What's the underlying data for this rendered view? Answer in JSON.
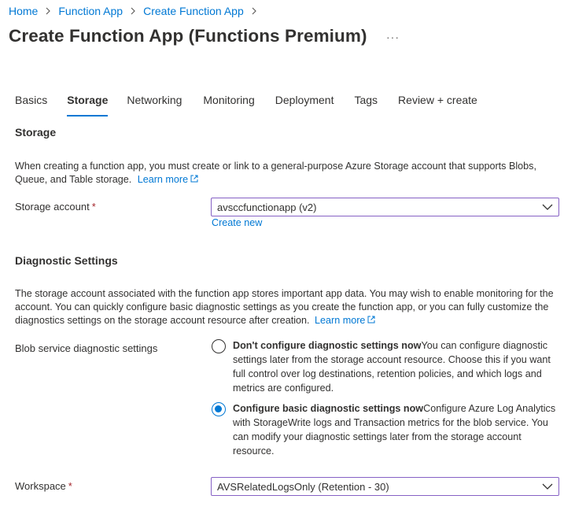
{
  "breadcrumb": {
    "items": [
      "Home",
      "Function App",
      "Create Function App"
    ]
  },
  "title": "Create Function App (Functions Premium)",
  "more_label": "···",
  "tabs": [
    {
      "label": "Basics"
    },
    {
      "label": "Storage"
    },
    {
      "label": "Networking"
    },
    {
      "label": "Monitoring"
    },
    {
      "label": "Deployment"
    },
    {
      "label": "Tags"
    },
    {
      "label": "Review + create"
    }
  ],
  "active_tab": "Storage",
  "storage": {
    "heading": "Storage",
    "description": "When creating a function app, you must create or link to a general-purpose Azure Storage account that supports Blobs, Queue, and Table storage.",
    "learn_more": "Learn more",
    "account_label": "Storage account",
    "account_required": "*",
    "account_value": "avsccfunctionapp (v2)",
    "create_new": "Create new"
  },
  "diagnostics": {
    "heading": "Diagnostic Settings",
    "description": "The storage account associated with the function app stores important app data. You may wish to enable monitoring for the account. You can quickly configure basic diagnostic settings as you create the function app, or you can fully customize the diagnostics settings on the storage account resource after creation.",
    "learn_more": "Learn more",
    "blob_label": "Blob service diagnostic settings",
    "options": [
      {
        "title": "Don't configure diagnostic settings now",
        "body": "You can configure diagnostic settings later from the storage account resource. Choose this if you want full control over log destinations, retention policies, and which logs and metrics are configured.",
        "checked": false
      },
      {
        "title": "Configure basic diagnostic settings now",
        "body": "Configure Azure Log Analytics with StorageWrite logs and Transaction metrics for the blob service. You can modify your diagnostic settings later from the storage account resource.",
        "checked": true
      }
    ],
    "workspace_label": "Workspace",
    "workspace_required": "*",
    "workspace_value": "AVSRelatedLogsOnly (Retention - 30)"
  },
  "colors": {
    "link": "#0078d4",
    "accent": "#0078d4",
    "required": "#a4262c",
    "dropdown_border": "#8661c5"
  }
}
